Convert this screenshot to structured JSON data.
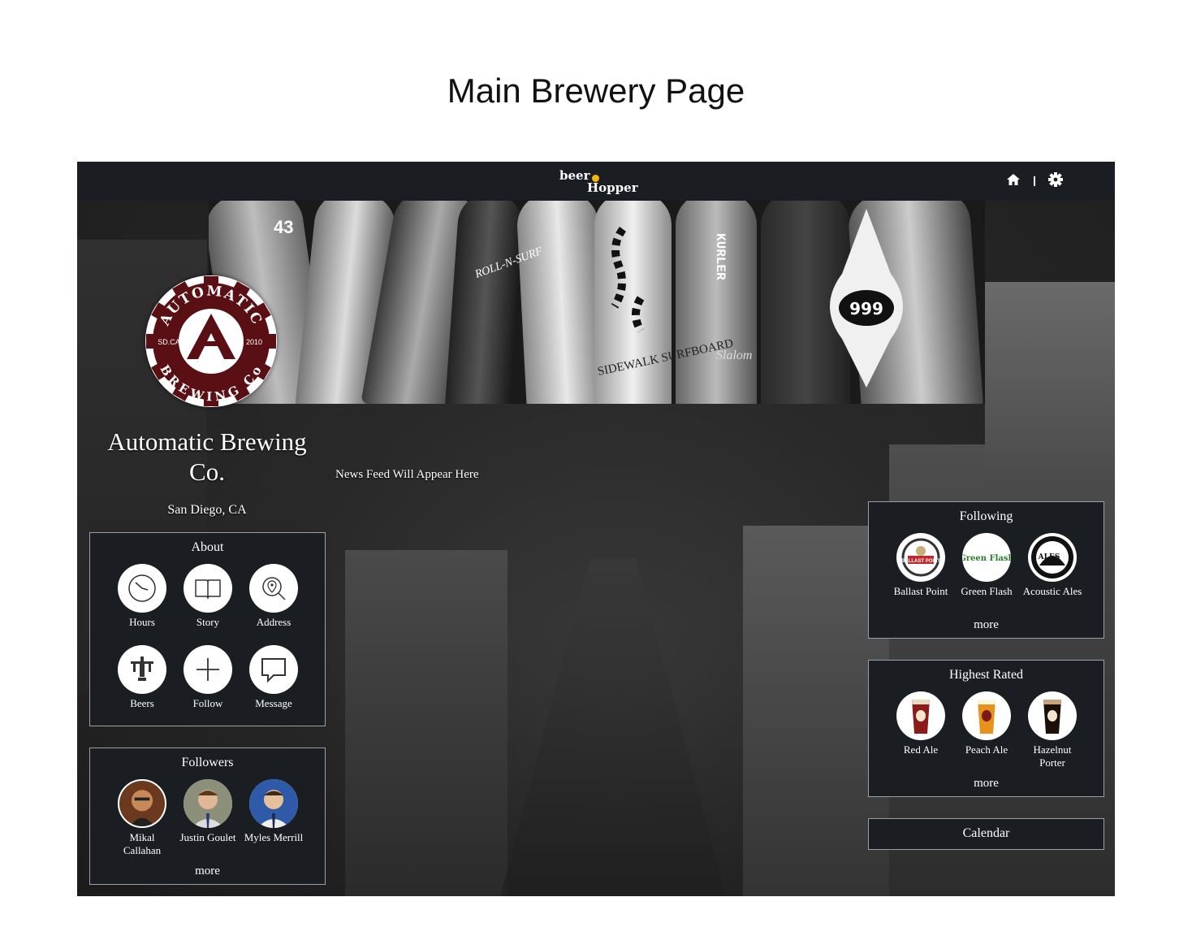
{
  "doc_title": "Main Brewery Page",
  "nav": {
    "logo_line1": "beer",
    "logo_line2": "Hopper",
    "home_icon": "home-icon",
    "settings_icon": "gear-icon"
  },
  "brewery": {
    "name": "Automatic Brewing Co.",
    "location": "San Diego, CA",
    "logo_top": "AUTOMATIC",
    "logo_bottom": "BREWING Co",
    "logo_left": "SD.CA",
    "logo_right": "2010"
  },
  "news_feed": "News Feed Will Appear Here",
  "about": {
    "title": "About",
    "items": [
      {
        "label": "Hours",
        "icon": "clock-icon"
      },
      {
        "label": "Story",
        "icon": "book-icon"
      },
      {
        "label": "Address",
        "icon": "map-pin-icon"
      },
      {
        "label": "Beers",
        "icon": "beer-tap-icon"
      },
      {
        "label": "Follow",
        "icon": "plus-icon"
      },
      {
        "label": "Message",
        "icon": "chat-icon"
      }
    ]
  },
  "followers": {
    "title": "Followers",
    "items": [
      {
        "label": "Mikal Callahan"
      },
      {
        "label": "Justin Goulet"
      },
      {
        "label": "Myles Merrill"
      }
    ],
    "more": "more"
  },
  "following": {
    "title": "Following",
    "items": [
      {
        "label": "Ballast Point",
        "logo_text": "BALLAST POINT"
      },
      {
        "label": "Green Flash",
        "logo_text": "Green Flash"
      },
      {
        "label": "Acoustic Ales",
        "logo_text": "ALES"
      }
    ],
    "more": "more"
  },
  "highest_rated": {
    "title": "Highest Rated",
    "items": [
      {
        "label": "Red Ale",
        "color": "#8b1a1a"
      },
      {
        "label": "Peach Ale",
        "color": "#e8921e"
      },
      {
        "label": "Hazelnut Porter",
        "color": "#1c0f08"
      }
    ],
    "more": "more"
  },
  "calendar": {
    "label": "Calendar"
  },
  "banner_text": {
    "board_number": "43",
    "board_999": "999",
    "kurler": "KURLER",
    "slalom": "Slalom",
    "sidewalk": "SIDEWALK SURFBOARD",
    "roll": "ROLL-N-SURF"
  }
}
